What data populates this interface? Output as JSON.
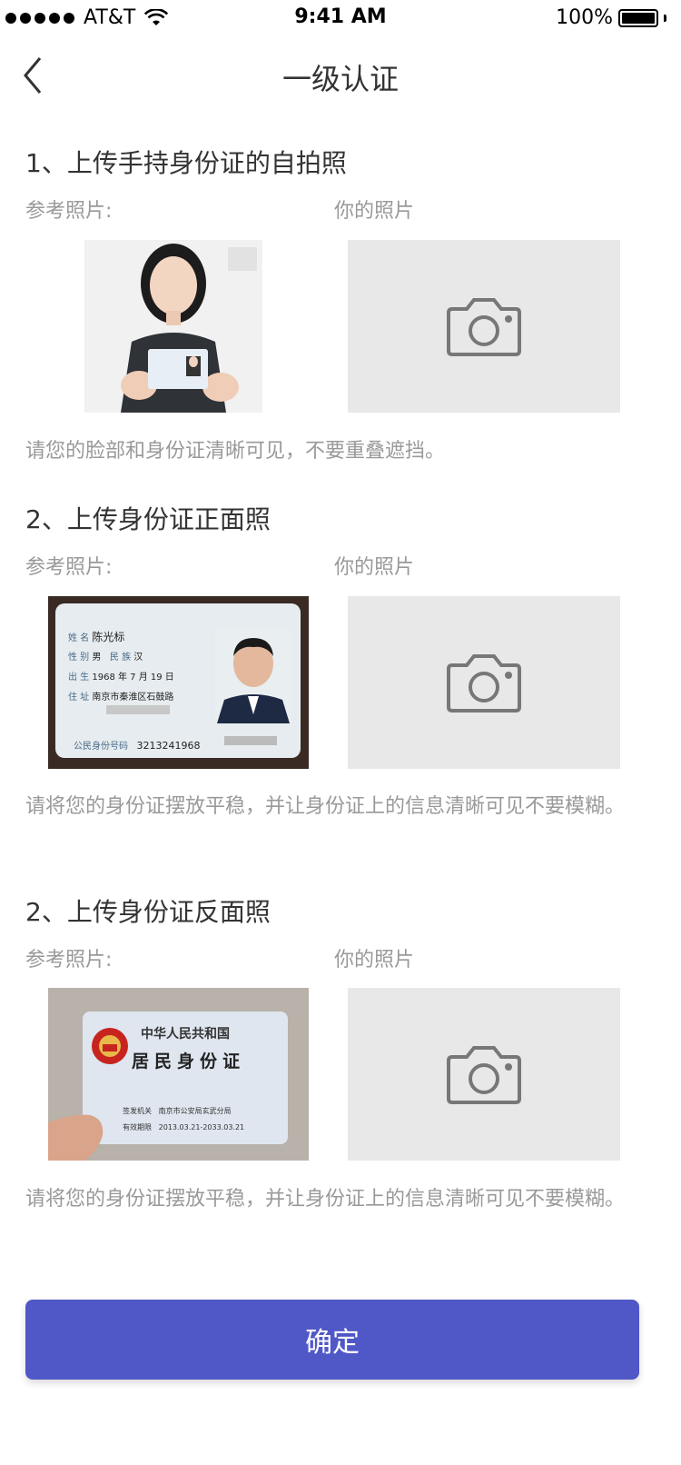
{
  "status_bar": {
    "carrier": "AT&T",
    "time": "9:41 AM",
    "battery": "100%"
  },
  "nav": {
    "title": "一级认证",
    "back_icon": "chevron-left-icon"
  },
  "sections": [
    {
      "title": "1、上传手持身份证的自拍照",
      "ref_label": "参考照片:",
      "your_label": "你的照片",
      "note": "请您的脸部和身份证清晰可见，不要重叠遮挡。"
    },
    {
      "title": "2、上传身份证正面照",
      "ref_label": "参考照片:",
      "your_label": "你的照片",
      "note": "请将您的身份证摆放平稳，并让身份证上的信息清晰可见不要模糊。",
      "card": {
        "name_label": "姓 名",
        "name": "陈光标",
        "sex_label": "性 别",
        "sex": "男",
        "ethnic_label": "民 族",
        "ethnic": "汉",
        "birth_label": "出 生",
        "birth": "1968 年 7 月 19 日",
        "addr_label": "住 址",
        "addr": "南京市秦淮区石鼓路",
        "id_label": "公民身份号码",
        "id": "3213241968"
      }
    },
    {
      "title": "2、上传身份证反面照",
      "ref_label": "参考照片:",
      "your_label": "你的照片",
      "note": "请将您的身份证摆放平稳，并让身份证上的信息清晰可见不要模糊。",
      "card": {
        "country": "中华人民共和国",
        "doc": "居民身份证",
        "authority_label": "签发机关",
        "authority": "南京市公安局玄武分局",
        "validity_label": "有效期限",
        "validity": "2013.03.21-2033.03.21"
      }
    }
  ],
  "confirm_button": "确定",
  "colors": {
    "accent": "#5058c8",
    "placeholder": "#e8e8e8",
    "muted_text": "#999999"
  }
}
